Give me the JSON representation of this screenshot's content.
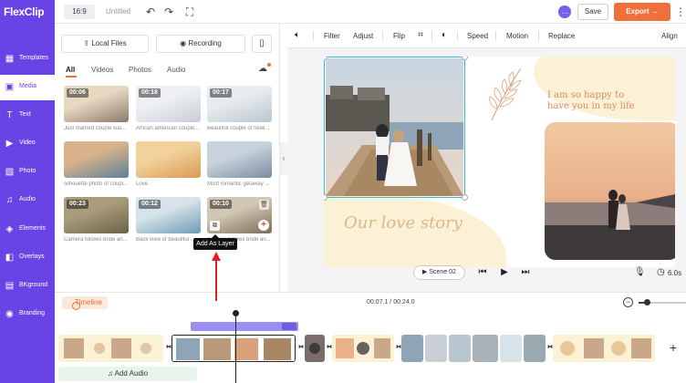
{
  "app": {
    "logo": "FlexClip",
    "ratio": "16:9",
    "doc_title": "Untitled",
    "save_label": "Save",
    "export_label": "Export →",
    "more": "⋮"
  },
  "nav": [
    {
      "label": "Templates",
      "icon": "▦"
    },
    {
      "label": "Media",
      "icon": "▣",
      "active": true
    },
    {
      "label": "Text",
      "icon": "T"
    },
    {
      "label": "Video",
      "icon": "▶"
    },
    {
      "label": "Photo",
      "icon": "▨"
    },
    {
      "label": "Audio",
      "icon": "♫"
    },
    {
      "label": "Elements",
      "icon": "◈"
    },
    {
      "label": "Overlays",
      "icon": "◧"
    },
    {
      "label": "BKground",
      "icon": "▤"
    },
    {
      "label": "Branding",
      "icon": "◉"
    }
  ],
  "media": {
    "local_files": "Local Files",
    "recording": "Recording",
    "tabs": [
      "All",
      "Videos",
      "Photos",
      "Audio"
    ],
    "items": [
      {
        "duration": "00:06",
        "caption": "Just married couple wal...",
        "colors": [
          "#8c7a6a",
          "#e8d8c2"
        ]
      },
      {
        "duration": "00:18",
        "caption": "African american couple...",
        "colors": [
          "#c9cfd6",
          "#eef0f3"
        ]
      },
      {
        "duration": "00:17",
        "caption": "Beautiful couple of newl...",
        "colors": [
          "#b7c6cf",
          "#e9ecee"
        ]
      },
      {
        "duration": "",
        "caption": "silhouette photo of coupl...",
        "colors": [
          "#5d7f9a",
          "#d7b28a"
        ]
      },
      {
        "duration": "",
        "caption": "Love",
        "colors": [
          "#d99a52",
          "#f2d19a"
        ]
      },
      {
        "duration": "",
        "caption": "Most romantic getaway ...",
        "colors": [
          "#7b8da0",
          "#c7d2dc"
        ]
      },
      {
        "duration": "00:23",
        "caption": "Camera follows bride an...",
        "colors": [
          "#6b6147",
          "#a89c7a"
        ]
      },
      {
        "duration": "00:12",
        "caption": "Back view of beautiful ...",
        "colors": [
          "#6f9bb3",
          "#d7e3ea"
        ]
      },
      {
        "duration": "00:10",
        "caption": "Camera follows bride an...",
        "colors": [
          "#7a6d58",
          "#d2c7b3"
        ]
      }
    ],
    "tooltip": "Add As Layer"
  },
  "toolbar": {
    "filter": "Filter",
    "adjust": "Adjust",
    "flip": "Flip",
    "speed": "Speed",
    "motion": "Motion",
    "replace": "Replace",
    "align": "Align"
  },
  "canvas": {
    "text_line1": "I am so happy to",
    "text_line2": "have you in my life",
    "love_story": "Our love story",
    "scene": "Scene 02",
    "duration": "6.0s"
  },
  "timeline": {
    "label": "Timeline",
    "time": "00:07.1 / 00:24.0",
    "add_audio": "Add Audio"
  },
  "colors": {
    "brand": "#6a43e6",
    "accent": "#f06f3a",
    "selection": "#33b8d6"
  }
}
